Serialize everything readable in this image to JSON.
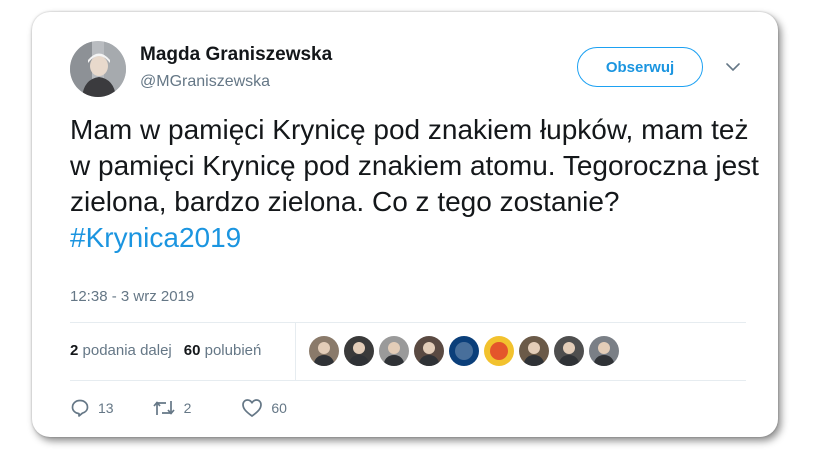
{
  "author": {
    "name": "Magda Graniszewska",
    "handle": "@MGraniszewska"
  },
  "follow_button": {
    "label": "Obserwuj"
  },
  "tweet": {
    "text": "Mam w pamięci Krynicę pod znakiem łupków, mam też w pamięci Krynicę pod znakiem atomu. Tegoroczna jest zielona, bardzo zielona. Co z tego zostanie?",
    "hashtag": "#Krynica2019",
    "timestamp": "12:38 - 3 wrz 2019"
  },
  "stats": {
    "retweets_count": "2",
    "retweets_label": "podania dalej",
    "likes_count": "60",
    "likes_label": "polubień"
  },
  "liker_avatars": [
    {
      "kind": "photo",
      "bg": "#8a7a6a"
    },
    {
      "kind": "photo",
      "bg": "#3a3a3a"
    },
    {
      "kind": "photo",
      "bg": "#9a9a9a"
    },
    {
      "kind": "photo",
      "bg": "#5a4a42"
    },
    {
      "kind": "logo",
      "bg": "#0b3f7a"
    },
    {
      "kind": "logo",
      "bg": "#f2c22e"
    },
    {
      "kind": "photo",
      "bg": "#6b5a48"
    },
    {
      "kind": "photo",
      "bg": "#4e4e4e"
    },
    {
      "kind": "photo",
      "bg": "#7a7f86"
    }
  ],
  "actions": {
    "reply_count": "13",
    "retweet_count": "2",
    "like_count": "60"
  },
  "colors": {
    "accent": "#1da1f2",
    "link": "#1b95e0",
    "text": "#14171a",
    "muted": "#657786"
  }
}
